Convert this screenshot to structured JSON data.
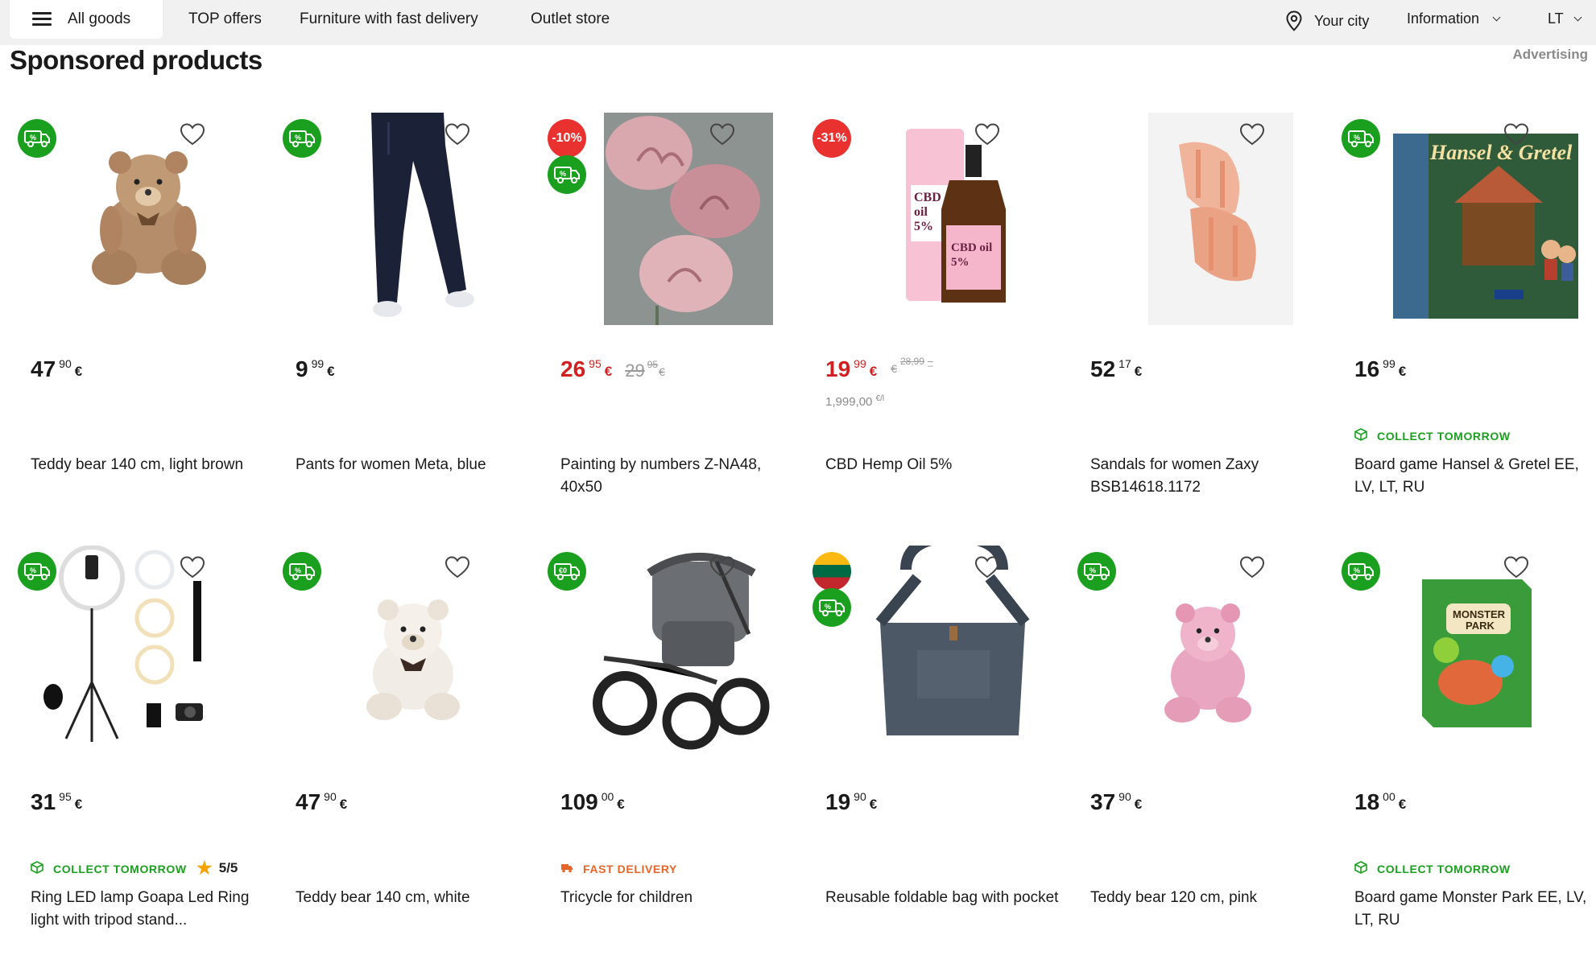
{
  "nav": {
    "all_goods": "All goods",
    "links": [
      "TOP offers",
      "Furniture with fast delivery",
      "Outlet store"
    ],
    "city": "Your city",
    "information": "Information",
    "language": "LT"
  },
  "section": {
    "title": "Sponsored products",
    "advertising": "Advertising"
  },
  "colors": {
    "green": "#1aa01e",
    "red": "#e9312f",
    "sale": "#d21f1f",
    "orange": "#e8652a"
  },
  "products": [
    {
      "title": "Teddy bear 140 cm, light brown",
      "price_int": "47",
      "price_cents": "90",
      "currency": "€",
      "badges": [
        "delivery-discount"
      ],
      "image": "brown-teddy-bear"
    },
    {
      "title": "Pants for women Meta, blue",
      "price_int": "9",
      "price_cents": "99",
      "currency": "€",
      "badges": [
        "delivery-discount"
      ],
      "image": "navy-pants"
    },
    {
      "title": "Painting by numbers Z-NA48, 40x50",
      "price_int": "26",
      "price_cents": "95",
      "currency": "€",
      "old_int": "29",
      "old_cents": "95",
      "old_currency": "€",
      "discount": "-10%",
      "badges": [
        "discount",
        "delivery-discount"
      ],
      "image": "pink-tulips-painting"
    },
    {
      "title": "CBD Hemp Oil 5%",
      "price_int": "19",
      "price_cents": "99",
      "currency": "€",
      "old_prefix": "€",
      "old_small": "28,99",
      "old_dash": "_",
      "unit_price": "1,999,00",
      "unit": "€/l",
      "discount": "-31%",
      "badges": [
        "discount"
      ],
      "image": "cbd-oil-bottle"
    },
    {
      "title": "Sandals for women Zaxy BSB14618.1172",
      "price_int": "52",
      "price_cents": "17",
      "currency": "€",
      "badges": [],
      "image": "pink-sandals"
    },
    {
      "title": "Board game Hansel & Gretel EE, LV, LT, RU",
      "price_int": "16",
      "price_cents": "99",
      "currency": "€",
      "tag": "COLLECT TOMORROW",
      "badges": [
        "delivery-discount"
      ],
      "image": "hansel-gretel-box"
    },
    {
      "title": "Ring LED lamp Goapa Led Ring light with tripod stand...",
      "price_int": "31",
      "price_cents": "95",
      "currency": "€",
      "tag": "COLLECT TOMORROW",
      "rating": "5/5",
      "badges": [
        "delivery-discount"
      ],
      "image": "ring-light-kit"
    },
    {
      "title": "Teddy bear 140 cm, white",
      "price_int": "47",
      "price_cents": "90",
      "currency": "€",
      "badges": [
        "delivery-discount"
      ],
      "image": "white-teddy-bear"
    },
    {
      "title": "Tricycle for children",
      "price_int": "109",
      "price_cents": "00",
      "currency": "€",
      "tag": "FAST DELIVERY",
      "badges": [
        "free-delivery"
      ],
      "image": "grey-tricycle"
    },
    {
      "title": "Reusable foldable bag with pocket",
      "price_int": "19",
      "price_cents": "90",
      "currency": "€",
      "badges": [
        "lithuanian-flag",
        "delivery-discount"
      ],
      "image": "denim-bag"
    },
    {
      "title": "Teddy bear 120 cm, pink",
      "price_int": "37",
      "price_cents": "90",
      "currency": "€",
      "badges": [
        "delivery-discount"
      ],
      "image": "pink-teddy-bear"
    },
    {
      "title": "Board game Monster Park EE, LV, LT, RU",
      "price_int": "18",
      "price_cents": "00",
      "currency": "€",
      "tag": "COLLECT TOMORROW",
      "badges": [
        "delivery-discount"
      ],
      "image": "monster-park-box"
    }
  ]
}
